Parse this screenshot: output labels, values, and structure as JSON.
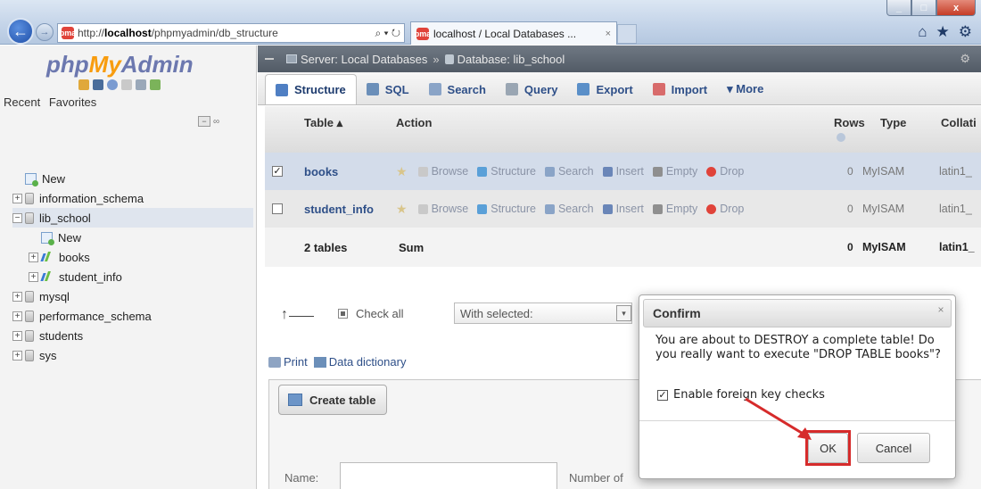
{
  "browser": {
    "url_prefix": "http://",
    "url_host": "localhost",
    "url_path": "/phpmyadmin/db_structure",
    "url_tools": "⌕ ▾ ↻",
    "tab_title": "localhost / Local Databases ...",
    "tab_close": "×",
    "favicon_text": "pma",
    "win_min": "_",
    "win_max": "□",
    "win_close": "x",
    "nav_back": "←",
    "nav_fwd": "→",
    "icons": {
      "home": "⌂",
      "star": "★",
      "gear": "⚙"
    }
  },
  "sidebar": {
    "logo": {
      "php": "php",
      "my": "My",
      "admin": "Admin"
    },
    "recent": "Recent",
    "favorites": "Favorites",
    "collapse": "−",
    "link": "∞",
    "tree": [
      {
        "label": "New",
        "kind": "new",
        "indent": 0
      },
      {
        "label": "information_schema",
        "kind": "db",
        "indent": 0,
        "expander": "+"
      },
      {
        "label": "lib_school",
        "kind": "db",
        "indent": 0,
        "expander": "−",
        "selected": true
      },
      {
        "label": "New",
        "kind": "new",
        "indent": 1
      },
      {
        "label": "books",
        "kind": "table",
        "indent": 1,
        "expander": "+"
      },
      {
        "label": "student_info",
        "kind": "table",
        "indent": 1,
        "expander": "+"
      },
      {
        "label": "mysql",
        "kind": "db",
        "indent": 0,
        "expander": "+"
      },
      {
        "label": "performance_schema",
        "kind": "db",
        "indent": 0,
        "expander": "+"
      },
      {
        "label": "students",
        "kind": "db",
        "indent": 0,
        "expander": "+"
      },
      {
        "label": "sys",
        "kind": "db",
        "indent": 0,
        "expander": "+"
      }
    ]
  },
  "breadcrumb": {
    "server": "Server: Local Databases",
    "sep": "»",
    "database": "Database: lib_school"
  },
  "tabs": [
    {
      "label": "Structure",
      "active": true,
      "icon_color": "#4f7fc3"
    },
    {
      "label": "SQL",
      "icon_color": "#6b8fb9"
    },
    {
      "label": "Search",
      "icon_color": "#8aa4c7"
    },
    {
      "label": "Query",
      "icon_color": "#9aa6b3"
    },
    {
      "label": "Export",
      "icon_color": "#5a8fc8"
    },
    {
      "label": "Import",
      "icon_color": "#d86b6b"
    },
    {
      "label": "▾ More",
      "icon_color": ""
    }
  ],
  "table": {
    "headers": {
      "table": "Table ▴",
      "action": "Action",
      "rows": "Rows",
      "type": "Type",
      "collation": "Collati"
    },
    "rows": [
      {
        "checked": "✓",
        "name": "books",
        "rows": "0",
        "type": "MyISAM",
        "collation": "latin1_"
      },
      {
        "checked": "",
        "name": "student_info",
        "rows": "0",
        "type": "MyISAM",
        "collation": "latin1_"
      }
    ],
    "actions": [
      "Browse",
      "Structure",
      "Search",
      "Insert",
      "Empty",
      "Drop"
    ],
    "summary": {
      "label": "2 tables",
      "sum": "Sum",
      "rows": "0",
      "type": "MyISAM",
      "collation": "latin1_"
    }
  },
  "bulk": {
    "check_all": "Check all",
    "with_selected": "With selected:"
  },
  "print_bar": {
    "print": "Print",
    "dictionary": "Data dictionary"
  },
  "create": {
    "button": "Create table",
    "name_label": "Name:",
    "number_label": "Number of"
  },
  "dialog": {
    "title": "Confirm",
    "close": "×",
    "message": "You are about to DESTROY a complete table! Do you really want to execute \"DROP TABLE books\"?",
    "fk_label": "Enable foreign key checks",
    "fk_checked": "✓",
    "ok": "OK",
    "cancel": "Cancel"
  },
  "colors": {
    "highlight_red": "#d62b2b",
    "link_blue": "#2e4f88",
    "selected_row": "#d3dcea",
    "breadcrumb_bg": "#5f6873",
    "logo_orange": "#f89c0e",
    "logo_purple": "#6c78af"
  }
}
